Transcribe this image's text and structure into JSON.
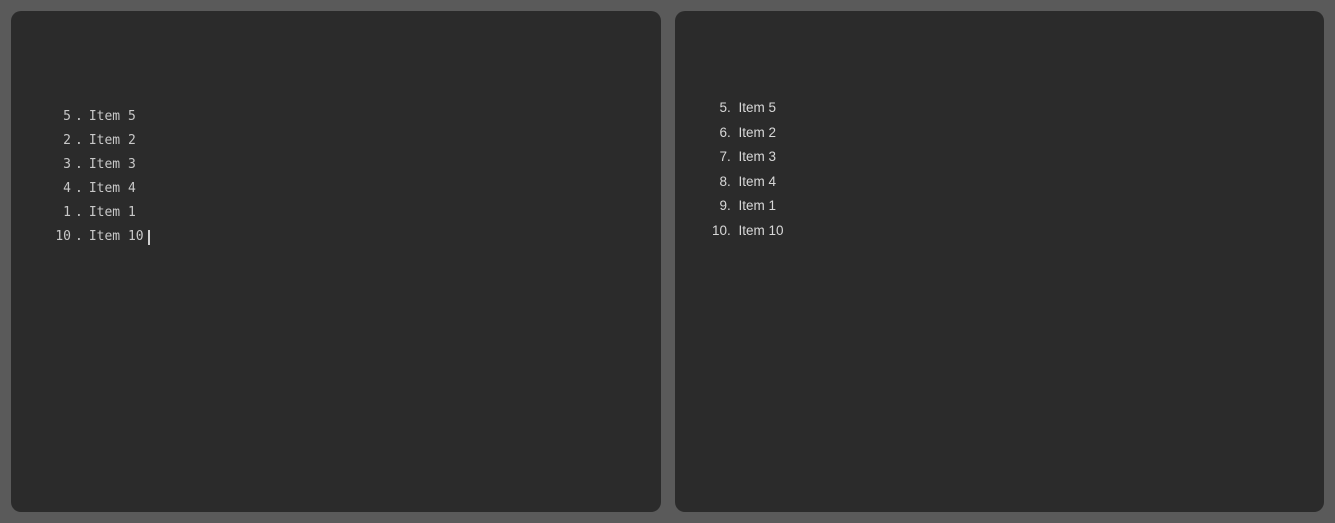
{
  "editor": {
    "items": [
      {
        "number": "5",
        "label": "Item 5"
      },
      {
        "number": "2",
        "label": "Item 2"
      },
      {
        "number": "3",
        "label": "Item 3"
      },
      {
        "number": "4",
        "label": "Item 4"
      },
      {
        "number": "1",
        "label": "Item 1"
      },
      {
        "number": "10",
        "label": "Item 10"
      }
    ],
    "cursor_after_index": 5
  },
  "preview": {
    "start": 5,
    "items": [
      "Item 5",
      "Item 2",
      "Item 3",
      "Item 4",
      "Item 1",
      "Item 10"
    ]
  }
}
